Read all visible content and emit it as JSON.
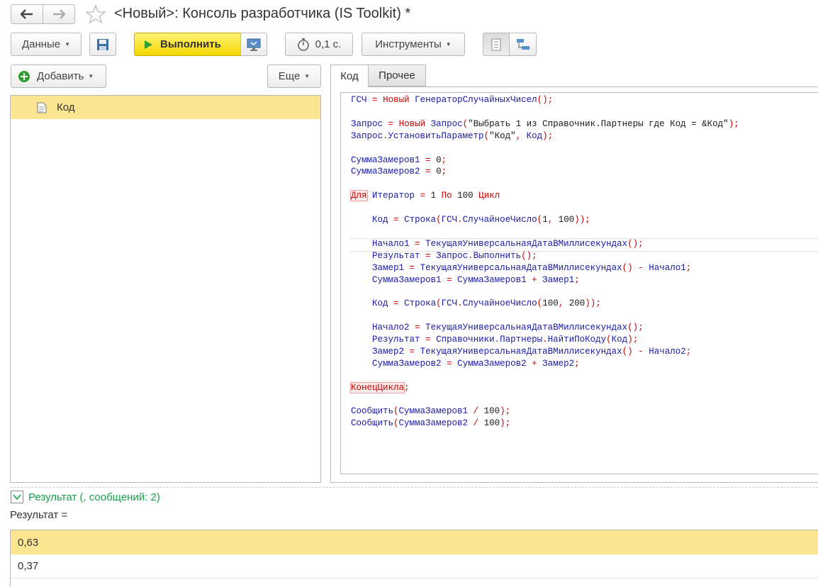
{
  "window": {
    "title": "<Новый>: Консоль разработчика (IS Toolkit) *"
  },
  "toolbar": {
    "data_label": "Данные",
    "run_label": "Выполнить",
    "timer_label": "0,1 с.",
    "tools_label": "Инструменты"
  },
  "left_panel": {
    "add_label": "Добавить",
    "more_label": "Еще",
    "tree_items": [
      {
        "label": "Код"
      }
    ]
  },
  "tabs": [
    {
      "label": "Код",
      "active": true
    },
    {
      "label": "Прочее",
      "active": false
    }
  ],
  "code_lines": [
    "ГСЧ = Новый ГенераторСлучайныхЧисел();",
    "",
    "Запрос = Новый Запрос(\"Выбрать 1 из Справочник.Партнеры где Код = &Код\");",
    "Запрос.УстановитьПараметр(\"Код\", Код);",
    "",
    "СуммаЗамеров1 = 0;",
    "СуммаЗамеров2 = 0;",
    "",
    "Для Итератор = 1 По 100 Цикл",
    "",
    "    Код = Строка(ГСЧ.СлучайноеЧисло(1, 100));",
    "",
    "    Начало1 = ТекущаяУниверсальнаяДатаВМиллисекундах();",
    "    Результат = Запрос.Выполнить();",
    "    Замер1 = ТекущаяУниверсальнаяДатаВМиллисекундах() - Начало1;",
    "    СуммаЗамеров1 = СуммаЗамеров1 + Замер1;",
    "",
    "    Код = Строка(ГСЧ.СлучайноеЧисло(100, 200));",
    "",
    "    Начало2 = ТекущаяУниверсальнаяДатаВМиллисекундах();",
    "    Результат = Справочники.Партнеры.НайтиПоКоду(Код);",
    "    Замер2 = ТекущаяУниверсальнаяДатаВМиллисекундах() - Начало2;",
    "    СуммаЗамеров2 = СуммаЗамеров2 + Замер2;",
    "",
    "КонецЦикла;",
    "",
    "Сообщить(СуммаЗамеров1 / 100);",
    "Сообщить(СуммаЗамеров2 / 100);"
  ],
  "result": {
    "header": "Результат (, сообщений: 2)",
    "label": "Результат =",
    "rows": [
      "0,63",
      "0,37"
    ]
  },
  "colors": {
    "accent_yellow": "#fce591",
    "run_yellow": "#f5d800",
    "green": "#1a9e4a",
    "keyword_red": "#d00000",
    "identifier_blue": "#1a1aa6"
  }
}
